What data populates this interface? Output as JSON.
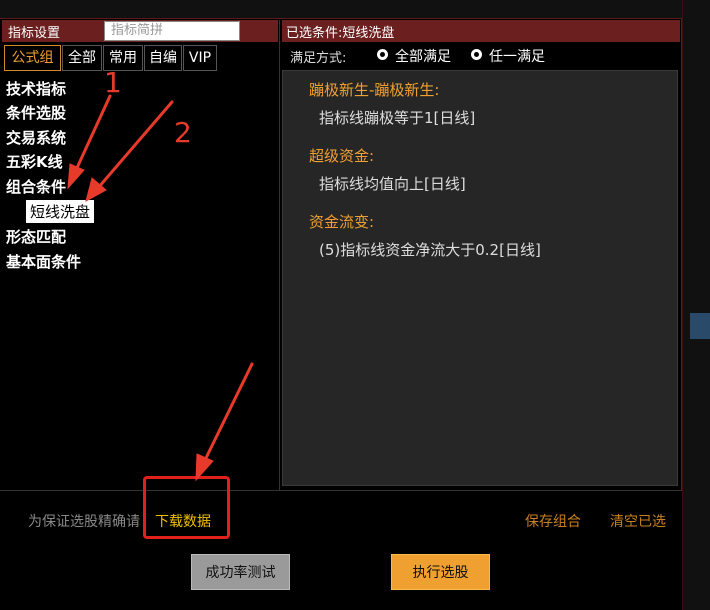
{
  "left_panel": {
    "title": "指标设置",
    "search_placeholder": "指标简拼",
    "tabs": [
      {
        "label": "公式组",
        "active": true
      },
      {
        "label": "全部",
        "active": false
      },
      {
        "label": "常用",
        "active": false
      },
      {
        "label": "自编",
        "active": false
      },
      {
        "label": "VIP",
        "active": false
      }
    ],
    "tree": [
      "技术指标",
      "条件选股",
      "交易系统",
      "五彩K线",
      "组合条件",
      "形态匹配",
      "基本面条件"
    ],
    "selected_child": "短线洗盘"
  },
  "right_panel": {
    "title": "已选条件:短线洗盘",
    "satisfy_label": "满足方式:",
    "options": [
      {
        "label": "全部满足",
        "selected": true
      },
      {
        "label": "任一满足",
        "selected": false
      }
    ],
    "conditions": [
      {
        "title": "蹦极新生-蹦极新生:",
        "detail": "指标线蹦极等于1[日线]"
      },
      {
        "title": "超级资金:",
        "detail": "指标线均值向上[日线]"
      },
      {
        "title": "资金流变:",
        "detail": "(5)指标线资金净流大于0.2[日线]"
      }
    ]
  },
  "bottom": {
    "hint": "为保证选股精确请",
    "download": "下载数据",
    "save": "保存组合",
    "clear": "清空已选",
    "test_button": "成功率测试",
    "exec_button": "执行选股"
  },
  "annotations": {
    "num1": "1",
    "num2": "2",
    "color": "#e83a2a"
  }
}
